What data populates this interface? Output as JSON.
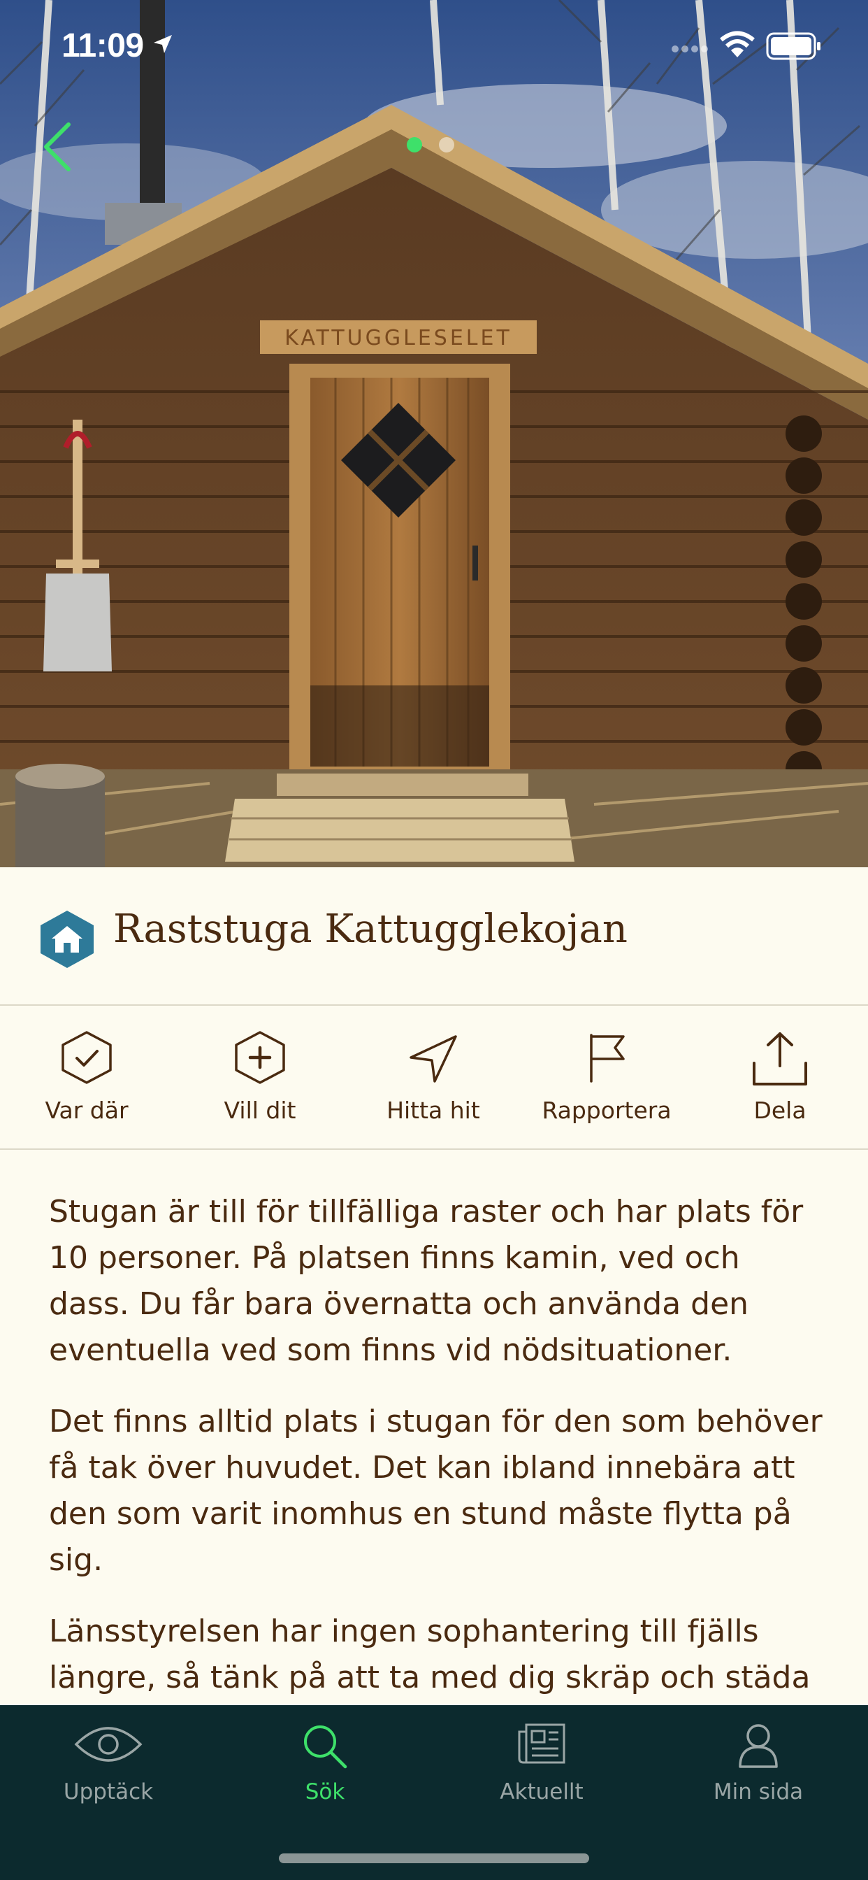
{
  "status_bar": {
    "time": "11:09"
  },
  "hero": {
    "sign_text": "KATTUGGLESELET",
    "page_count": 2,
    "active_page": 1
  },
  "place": {
    "title": "Raststuga Kattugglekojan",
    "type_icon": "house-icon"
  },
  "actions": [
    {
      "id": "been-there",
      "label": "Var där",
      "icon": "check-hexagon-icon"
    },
    {
      "id": "want-to-go",
      "label": "Vill dit",
      "icon": "plus-hexagon-icon"
    },
    {
      "id": "find-here",
      "label": "Hitta hit",
      "icon": "navigation-arrow-icon"
    },
    {
      "id": "report",
      "label": "Rapportera",
      "icon": "flag-icon"
    },
    {
      "id": "share",
      "label": "Dela",
      "icon": "share-icon"
    }
  ],
  "description": {
    "paragraphs": [
      "Stugan är till för tillfälliga raster och har plats för 10 personer. På platsen finns kamin, ved och dass. Du får bara övernatta och använda den eventuella ved som finns vid nödsituationer.",
      "Det finns alltid plats i stugan för den som behöver få tak över huvudet. Det kan ibland innebära att den som varit inomhus en stund måste flytta på sig.",
      "Länsstyrelsen har ingen sophantering till fjälls längre, så tänk på att ta med dig skräp och städa"
    ]
  },
  "tabs": [
    {
      "id": "discover",
      "label": "Upptäck",
      "icon": "eye-icon",
      "active": false
    },
    {
      "id": "search",
      "label": "Sök",
      "icon": "search-icon",
      "active": true
    },
    {
      "id": "news",
      "label": "Aktuellt",
      "icon": "newspaper-icon",
      "active": false
    },
    {
      "id": "my-page",
      "label": "Min sida",
      "icon": "person-icon",
      "active": false
    }
  ],
  "colors": {
    "accent": "#3ee06a",
    "text": "#4a2a10",
    "background": "#fdfbf0",
    "tabbar": "#0c2a2e",
    "house_badge": "#2e7a99"
  }
}
